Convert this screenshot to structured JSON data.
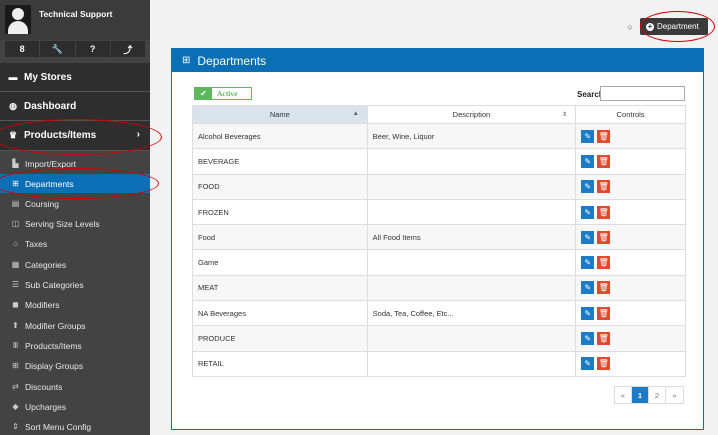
{
  "user": {
    "name": "Technical Support"
  },
  "quick_actions": [
    "8",
    "🔧",
    "?",
    "⤴"
  ],
  "sidebar": {
    "my_stores": "My Stores",
    "dashboard": "Dashboard",
    "products_items": "Products/Items",
    "items": [
      {
        "label": "Import/Export",
        "icon": "import-icon"
      },
      {
        "label": "Departments",
        "icon": "table-icon",
        "active": true
      },
      {
        "label": "Coursing",
        "icon": "coursing-icon"
      },
      {
        "label": "Serving Size Levels",
        "icon": "serving-size-icon"
      },
      {
        "label": "Taxes",
        "icon": "bank-icon"
      },
      {
        "label": "Categories",
        "icon": "categories-icon"
      },
      {
        "label": "Sub Categories",
        "icon": "list-icon"
      },
      {
        "label": "Modifiers",
        "icon": "modifier-icon"
      },
      {
        "label": "Modifier Groups",
        "icon": "group-icon"
      },
      {
        "label": "Products/Items",
        "icon": "product-icon"
      },
      {
        "label": "Display Groups",
        "icon": "grid-icon"
      },
      {
        "label": "Discounts",
        "icon": "discount-icon"
      },
      {
        "label": "Upcharges",
        "icon": "tag-icon"
      },
      {
        "label": "Sort Menu Config",
        "icon": "sort-icon"
      }
    ]
  },
  "toolbar": {
    "add_department": "Department"
  },
  "panel": {
    "title": "Departments",
    "active_filter": "Active",
    "search_label": "Search",
    "search_value": "",
    "columns": [
      "Name",
      "Description",
      "Controls"
    ],
    "rows": [
      {
        "name": "Alcohol Beverages",
        "description": "Beer, Wine, Liquor"
      },
      {
        "name": "BEVERAGE",
        "description": ""
      },
      {
        "name": "FOOD",
        "description": ""
      },
      {
        "name": "FROZEN",
        "description": ""
      },
      {
        "name": "Food",
        "description": "All Food Items"
      },
      {
        "name": "Game",
        "description": ""
      },
      {
        "name": "MEAT",
        "description": ""
      },
      {
        "name": "NA Beverages",
        "description": "Soda, Tea, Coffee, Etc..."
      },
      {
        "name": "PRODUCE",
        "description": ""
      },
      {
        "name": "RETAIL",
        "description": ""
      }
    ],
    "pagination": {
      "prev": "«",
      "pages": [
        "1",
        "2"
      ],
      "current": "1",
      "next": "»"
    }
  },
  "colors": {
    "accent": "#0a6fb5",
    "sidebar": "#434343",
    "edit": "#1a7bc8",
    "delete": "#e24a2e",
    "active_green": "#5cb85c",
    "annotation": "#d40000"
  }
}
